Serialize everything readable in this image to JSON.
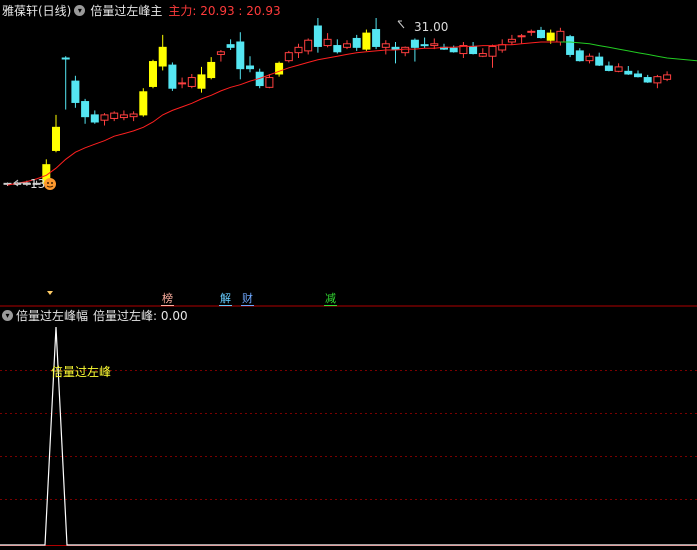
{
  "main_header": {
    "stock_title": "雅葆轩(日线)",
    "indicator_name": "倍量过左峰主",
    "main_force_label": "主力: 20.93 : 20.93"
  },
  "sub_header": {
    "indicator_name": "倍量过左峰幅",
    "line_label": "倍量过左峰: 0.00"
  },
  "annotations": {
    "high_price": "31.00",
    "low_price": "13",
    "peak_label": "倍量过左峰"
  },
  "event_tags": [
    {
      "text": "榜",
      "color": "#ffb0a0"
    },
    {
      "text": "解",
      "color": "#66ccff"
    },
    {
      "text": "财",
      "color": "#6fa8ff"
    },
    {
      "text": "减",
      "color": "#33dd33"
    }
  ],
  "colors": {
    "background": "#000000",
    "up_candle": "#ff4040",
    "down_candle": "#55e6f2",
    "signal_candle": "#ffff00",
    "ma_rising": "#ff2020",
    "ma_falling": "#22cc22",
    "divider": "#b00000",
    "grid": "#7a0000"
  },
  "chart_data": {
    "type": "candlestick",
    "candles": [
      {
        "o": 13.2,
        "h": 13.4,
        "l": 13.0,
        "c": 13.3,
        "k": "doji"
      },
      {
        "o": 13.3,
        "h": 13.5,
        "l": 13.1,
        "c": 13.2,
        "k": "doji"
      },
      {
        "o": 13.2,
        "h": 13.6,
        "l": 13.0,
        "c": 13.3,
        "k": "doji"
      },
      {
        "o": 13.3,
        "h": 13.6,
        "l": 13.1,
        "c": 13.25,
        "k": "doji"
      },
      {
        "o": 13.3,
        "h": 16.0,
        "l": 13.1,
        "c": 15.4,
        "k": "sig"
      },
      {
        "o": 17.0,
        "h": 21.0,
        "l": 16.8,
        "c": 19.6,
        "k": "sig"
      },
      {
        "o": 27.4,
        "h": 27.6,
        "l": 21.6,
        "c": 27.3,
        "k": "down"
      },
      {
        "o": 24.8,
        "h": 25.4,
        "l": 21.8,
        "c": 22.4,
        "k": "down"
      },
      {
        "o": 22.5,
        "h": 22.8,
        "l": 20.0,
        "c": 20.8,
        "k": "down"
      },
      {
        "o": 21.0,
        "h": 21.5,
        "l": 20.0,
        "c": 20.2,
        "k": "down"
      },
      {
        "o": 20.4,
        "h": 21.2,
        "l": 19.8,
        "c": 21.0,
        "k": "up"
      },
      {
        "o": 20.6,
        "h": 21.4,
        "l": 20.3,
        "c": 21.2,
        "k": "up"
      },
      {
        "o": 20.7,
        "h": 21.5,
        "l": 20.4,
        "c": 21.0,
        "k": "up"
      },
      {
        "o": 20.8,
        "h": 21.4,
        "l": 20.3,
        "c": 21.1,
        "k": "up"
      },
      {
        "o": 21.0,
        "h": 24.0,
        "l": 20.8,
        "c": 23.6,
        "k": "sig"
      },
      {
        "o": 24.2,
        "h": 27.2,
        "l": 24.0,
        "c": 27.0,
        "k": "sig"
      },
      {
        "o": 26.5,
        "h": 30.0,
        "l": 26.0,
        "c": 28.6,
        "k": "sig"
      },
      {
        "o": 26.6,
        "h": 26.9,
        "l": 23.7,
        "c": 24.0,
        "k": "down"
      },
      {
        "o": 24.5,
        "h": 25.2,
        "l": 24.0,
        "c": 24.6,
        "k": "up"
      },
      {
        "o": 24.2,
        "h": 25.6,
        "l": 24.0,
        "c": 25.2,
        "k": "up"
      },
      {
        "o": 24.0,
        "h": 26.4,
        "l": 23.5,
        "c": 25.5,
        "k": "sig"
      },
      {
        "o": 25.2,
        "h": 27.5,
        "l": 25.0,
        "c": 26.9,
        "k": "sig"
      },
      {
        "o": 27.8,
        "h": 28.3,
        "l": 27.0,
        "c": 28.1,
        "k": "up"
      },
      {
        "o": 28.9,
        "h": 29.5,
        "l": 28.3,
        "c": 28.6,
        "k": "down"
      },
      {
        "o": 29.2,
        "h": 30.3,
        "l": 25.0,
        "c": 26.2,
        "k": "down"
      },
      {
        "o": 26.5,
        "h": 27.6,
        "l": 25.8,
        "c": 26.2,
        "k": "down"
      },
      {
        "o": 25.8,
        "h": 26.2,
        "l": 24.0,
        "c": 24.3,
        "k": "down"
      },
      {
        "o": 24.1,
        "h": 25.6,
        "l": 24.0,
        "c": 25.2,
        "k": "up"
      },
      {
        "o": 25.6,
        "h": 27.0,
        "l": 25.3,
        "c": 26.8,
        "k": "sig"
      },
      {
        "o": 27.1,
        "h": 28.2,
        "l": 26.9,
        "c": 28.0,
        "k": "up"
      },
      {
        "o": 28.0,
        "h": 29.0,
        "l": 27.4,
        "c": 28.6,
        "k": "up"
      },
      {
        "o": 28.2,
        "h": 29.6,
        "l": 27.8,
        "c": 29.4,
        "k": "up"
      },
      {
        "o": 31.0,
        "h": 31.9,
        "l": 28.0,
        "c": 28.7,
        "k": "down"
      },
      {
        "o": 29.5,
        "h": 30.2,
        "l": 28.6,
        "c": 28.8,
        "k": "up"
      },
      {
        "o": 28.8,
        "h": 29.5,
        "l": 27.9,
        "c": 28.1,
        "k": "down"
      },
      {
        "o": 28.6,
        "h": 29.4,
        "l": 28.4,
        "c": 29.0,
        "k": "up"
      },
      {
        "o": 29.6,
        "h": 30.0,
        "l": 28.2,
        "c": 28.6,
        "k": "down"
      },
      {
        "o": 28.4,
        "h": 30.6,
        "l": 28.2,
        "c": 30.2,
        "k": "sig"
      },
      {
        "o": 30.6,
        "h": 31.9,
        "l": 28.4,
        "c": 28.7,
        "k": "down"
      },
      {
        "o": 28.6,
        "h": 29.4,
        "l": 27.8,
        "c": 29.0,
        "k": "up"
      },
      {
        "o": 28.6,
        "h": 29.2,
        "l": 26.8,
        "c": 28.4,
        "k": "down"
      },
      {
        "o": 28.0,
        "h": 28.7,
        "l": 27.6,
        "c": 28.6,
        "k": "up"
      },
      {
        "o": 29.4,
        "h": 29.6,
        "l": 27.0,
        "c": 28.6,
        "k": "down"
      },
      {
        "o": 28.9,
        "h": 29.7,
        "l": 28.5,
        "c": 28.8,
        "k": "down"
      },
      {
        "o": 28.8,
        "h": 29.6,
        "l": 28.4,
        "c": 29.0,
        "k": "up"
      },
      {
        "o": 28.6,
        "h": 29.0,
        "l": 28.3,
        "c": 28.4,
        "k": "down"
      },
      {
        "o": 28.5,
        "h": 28.8,
        "l": 28.0,
        "c": 28.1,
        "k": "down"
      },
      {
        "o": 27.9,
        "h": 29.2,
        "l": 27.4,
        "c": 28.8,
        "k": "up"
      },
      {
        "o": 28.7,
        "h": 29.2,
        "l": 27.8,
        "c": 27.9,
        "k": "down"
      },
      {
        "o": 27.9,
        "h": 28.5,
        "l": 27.5,
        "c": 27.6,
        "k": "up"
      },
      {
        "o": 27.6,
        "h": 28.9,
        "l": 26.3,
        "c": 28.7,
        "k": "up"
      },
      {
        "o": 28.3,
        "h": 29.5,
        "l": 28.0,
        "c": 28.9,
        "k": "up"
      },
      {
        "o": 29.2,
        "h": 30.0,
        "l": 28.9,
        "c": 29.5,
        "k": "up"
      },
      {
        "o": 29.8,
        "h": 30.1,
        "l": 29.0,
        "c": 29.9,
        "k": "up"
      },
      {
        "o": 30.4,
        "h": 30.6,
        "l": 29.9,
        "c": 30.3,
        "k": "up"
      },
      {
        "o": 30.5,
        "h": 30.9,
        "l": 29.6,
        "c": 29.7,
        "k": "down"
      },
      {
        "o": 29.4,
        "h": 30.6,
        "l": 29.0,
        "c": 30.2,
        "k": "sig"
      },
      {
        "o": 29.2,
        "h": 30.8,
        "l": 28.8,
        "c": 30.4,
        "k": "up"
      },
      {
        "o": 29.8,
        "h": 30.0,
        "l": 27.5,
        "c": 27.8,
        "k": "down"
      },
      {
        "o": 28.2,
        "h": 28.5,
        "l": 27.0,
        "c": 27.1,
        "k": "down"
      },
      {
        "o": 27.1,
        "h": 27.9,
        "l": 26.8,
        "c": 27.6,
        "k": "up"
      },
      {
        "o": 27.5,
        "h": 28.0,
        "l": 26.5,
        "c": 26.6,
        "k": "down"
      },
      {
        "o": 26.5,
        "h": 27.0,
        "l": 25.9,
        "c": 26.0,
        "k": "down"
      },
      {
        "o": 25.9,
        "h": 26.8,
        "l": 25.8,
        "c": 26.4,
        "k": "up"
      },
      {
        "o": 25.9,
        "h": 26.5,
        "l": 25.5,
        "c": 25.6,
        "k": "down"
      },
      {
        "o": 25.6,
        "h": 26.0,
        "l": 25.2,
        "c": 25.3,
        "k": "down"
      },
      {
        "o": 25.2,
        "h": 25.5,
        "l": 24.6,
        "c": 24.7,
        "k": "down"
      },
      {
        "o": 24.6,
        "h": 25.5,
        "l": 24.0,
        "c": 25.3,
        "k": "up"
      },
      {
        "o": 25.0,
        "h": 25.9,
        "l": 24.8,
        "c": 25.5,
        "k": "up"
      }
    ],
    "ma_line": [
      13.1,
      13.3,
      13.5,
      13.8,
      14.2,
      15.0,
      16.0,
      16.8,
      17.3,
      17.7,
      18.1,
      18.6,
      18.9,
      19.2,
      19.6,
      20.2,
      21.0,
      21.5,
      21.9,
      22.3,
      22.8,
      23.2,
      23.7,
      24.1,
      24.4,
      24.8,
      25.1,
      25.5,
      25.9,
      26.3,
      26.6,
      26.9,
      27.2,
      27.4,
      27.6,
      27.8,
      28.0,
      28.1,
      28.2,
      28.3,
      28.3,
      28.4,
      28.4,
      28.5,
      28.5,
      28.6,
      28.6,
      28.7,
      28.7,
      28.8,
      28.8,
      28.9,
      28.9,
      29.0,
      29.1,
      29.2,
      29.2,
      29.2,
      29.2,
      29.1,
      29.0,
      28.8,
      28.6,
      28.4,
      28.2,
      28.0,
      27.8,
      27.6,
      27.4
    ],
    "ma_turn_index": 57,
    "price_range": [
      13.0,
      31.9
    ],
    "signal_series": {
      "name": "倍量过左峰",
      "values": [
        0,
        0,
        0,
        0,
        0,
        1,
        0,
        0,
        0,
        0,
        0,
        0,
        0,
        0,
        0,
        0,
        0,
        0,
        0,
        0,
        0,
        0,
        0,
        0,
        0,
        0,
        0,
        0,
        0,
        0,
        0,
        0,
        0,
        0,
        0,
        0,
        0,
        0,
        0,
        0,
        0,
        0,
        0,
        0,
        0,
        0,
        0,
        0,
        0,
        0,
        0,
        0,
        0,
        0,
        0,
        0,
        0,
        0,
        0,
        0,
        0,
        0,
        0,
        0,
        0,
        0,
        0,
        0,
        0
      ],
      "range": [
        0,
        1
      ]
    }
  }
}
